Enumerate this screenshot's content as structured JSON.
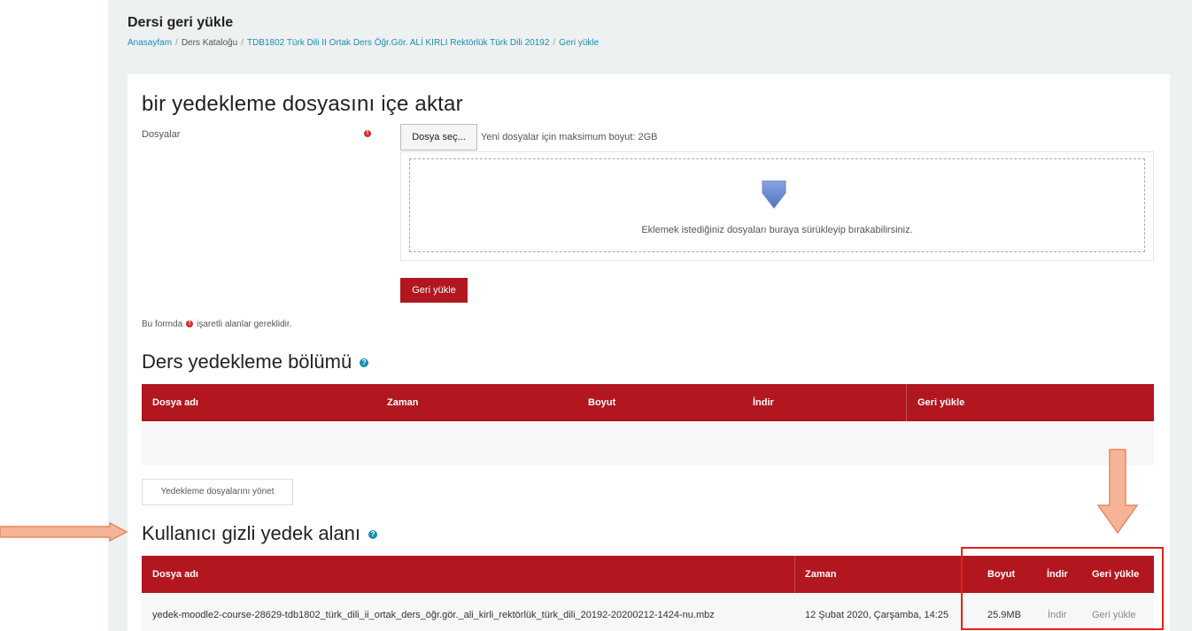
{
  "page": {
    "title": "Dersi geri yükle",
    "breadcrumb": [
      {
        "label": "Anasayfam",
        "link": true
      },
      {
        "label": "Ders Kataloğu",
        "link": false
      },
      {
        "label": "TDB1802 Türk Dili II Ortak Ders Öğr.Gör. ALİ KIRLI Rektörlük Türk Dili 20192",
        "link": true
      },
      {
        "label": "Geri yükle",
        "link": true
      }
    ]
  },
  "import": {
    "heading": "bir yedekleme dosyasını içe aktar",
    "files_label": "Dosyalar",
    "choose_button": "Dosya seç...",
    "max_size": "Yeni dosyalar için maksimum boyut: 2GB",
    "drop_text": "Eklemek istediğiniz dosyaları buraya sürükleyip bırakabilirsiniz.",
    "restore_button": "Geri yükle",
    "required_note_before": "Bu formda",
    "required_note_after": "işaretli alanlar gereklidir.",
    "required_mark": "!"
  },
  "course_backup": {
    "heading": "Ders yedekleme bölümü",
    "help_mark": "?",
    "columns": [
      "Dosya adı",
      "Zaman",
      "Boyut",
      "İndir",
      "Geri yükle"
    ],
    "manage_button": "Yedekleme dosyalarını yönet"
  },
  "user_backup": {
    "heading": "Kullanıcı gizli yedek alanı",
    "help_mark": "?",
    "columns": [
      "Dosya adı",
      "Zaman",
      "Boyut",
      "İndir",
      "Geri yükle"
    ],
    "rows": [
      {
        "filename": "yedek-moodle2-course-28629-tdb1802_türk_dili_ii_ortak_ders_öğr.gör._ali_kirli_rektörlük_türk_dili_20192-20200212-1424-nu.mbz",
        "time": "12 Şubat 2020, Çarşamba, 14:25",
        "size": "25.9MB",
        "download": "İndir",
        "restore": "Geri yükle"
      }
    ]
  },
  "colors": {
    "brand_red": "#b2161f",
    "link_blue": "#1b8db3",
    "annotation_orange": "#f4a07a",
    "highlight_red": "#e62117"
  }
}
